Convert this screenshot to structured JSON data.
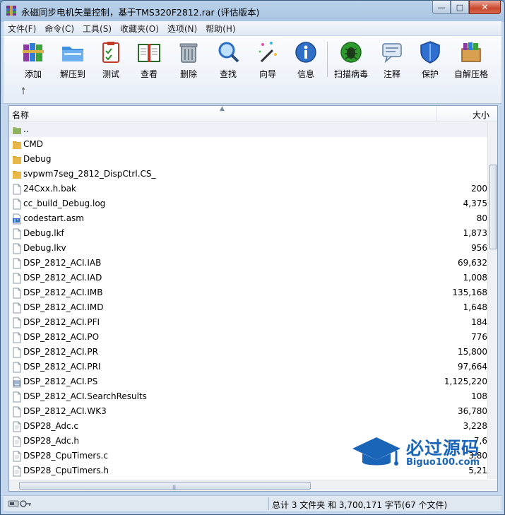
{
  "window": {
    "title": "永磁同步电机矢量控制，基于TMS320F2812.rar (评估版本)",
    "minimize": "—",
    "maximize": "□",
    "close": "✕"
  },
  "menu": [
    "文件(F)",
    "命令(C)",
    "工具(S)",
    "收藏夹(O)",
    "选项(N)",
    "帮助(H)"
  ],
  "toolbar": {
    "add": "添加",
    "extract_to": "解压到",
    "test": "测试",
    "view": "查看",
    "delete": "删除",
    "find": "查找",
    "wizard": "向导",
    "info": "信息",
    "virus_scan": "扫描病毒",
    "comment": "注释",
    "protect": "保护",
    "sfx": "自解压格"
  },
  "columns": {
    "name": "名称",
    "size": "大小"
  },
  "files": [
    {
      "name": "..",
      "size": "",
      "icon": "folder-up-icon"
    },
    {
      "name": "CMD",
      "size": "",
      "icon": "folder-icon"
    },
    {
      "name": "Debug",
      "size": "",
      "icon": "folder-icon"
    },
    {
      "name": "svpwm7seg_2812_DispCtrl.CS_",
      "size": "",
      "icon": "folder-icon"
    },
    {
      "name": "24Cxx.h.bak",
      "size": "200",
      "icon": "file-icon"
    },
    {
      "name": "cc_build_Debug.log",
      "size": "4,375",
      "icon": "file-icon"
    },
    {
      "name": "codestart.asm",
      "size": "80",
      "icon": "asm-file-icon"
    },
    {
      "name": "Debug.lkf",
      "size": "1,873",
      "icon": "file-icon"
    },
    {
      "name": "Debug.lkv",
      "size": "956",
      "icon": "file-icon"
    },
    {
      "name": "DSP_2812_ACI.IAB",
      "size": "69,632",
      "icon": "file-icon"
    },
    {
      "name": "DSP_2812_ACI.IAD",
      "size": "1,008",
      "icon": "file-icon"
    },
    {
      "name": "DSP_2812_ACI.IMB",
      "size": "135,168",
      "icon": "file-icon"
    },
    {
      "name": "DSP_2812_ACI.IMD",
      "size": "1,648",
      "icon": "file-icon"
    },
    {
      "name": "DSP_2812_ACI.PFI",
      "size": "184",
      "icon": "file-icon"
    },
    {
      "name": "DSP_2812_ACI.PO",
      "size": "776",
      "icon": "file-icon"
    },
    {
      "name": "DSP_2812_ACI.PR",
      "size": "15,800",
      "icon": "file-icon"
    },
    {
      "name": "DSP_2812_ACI.PRI",
      "size": "97,664",
      "icon": "file-icon"
    },
    {
      "name": "DSP_2812_ACI.PS",
      "size": "1,125,220",
      "icon": "ps-file-icon"
    },
    {
      "name": "DSP_2812_ACI.SearchResults",
      "size": "108",
      "icon": "file-icon"
    },
    {
      "name": "DSP_2812_ACI.WK3",
      "size": "36,780",
      "icon": "file-icon"
    },
    {
      "name": "DSP28_Adc.c",
      "size": "3,228",
      "icon": "source-file-icon"
    },
    {
      "name": "DSP28_Adc.h",
      "size": "7,6",
      "icon": "source-file-icon"
    },
    {
      "name": "DSP28_CpuTimers.c",
      "size": "3,80",
      "icon": "source-file-icon"
    },
    {
      "name": "DSP28_CpuTimers.h",
      "size": "5,21",
      "icon": "source-file-icon"
    }
  ],
  "status": {
    "summary": "总计 3 文件夹 和 3,700,171 字节(67 个文件)"
  },
  "watermark": {
    "text": "必过源码",
    "url": "Biguo100.com"
  },
  "colors": {
    "folder": "#e8b84a",
    "watermark": "#1b65b8"
  }
}
